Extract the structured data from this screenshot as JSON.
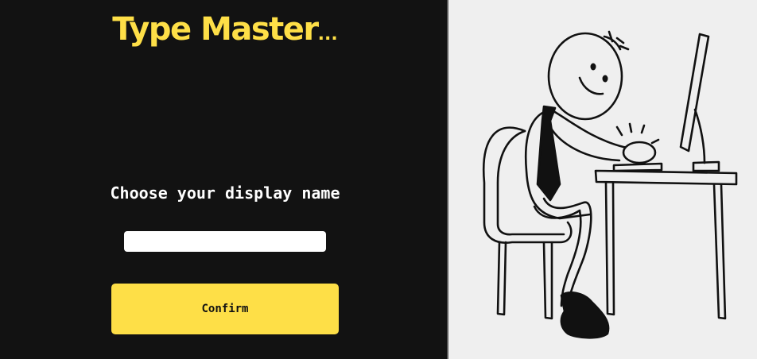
{
  "app": {
    "title": "Type Master",
    "title_suffix": "..."
  },
  "form": {
    "prompt": "Choose your display name",
    "name_value": "",
    "name_placeholder": "",
    "confirm_label": "Confirm"
  },
  "illustration": {
    "subject": "stick-figure-typing-at-computer"
  },
  "colors": {
    "accent": "#fedf47",
    "background": "#121212",
    "panel": "#efefef",
    "text": "#ffffff"
  }
}
